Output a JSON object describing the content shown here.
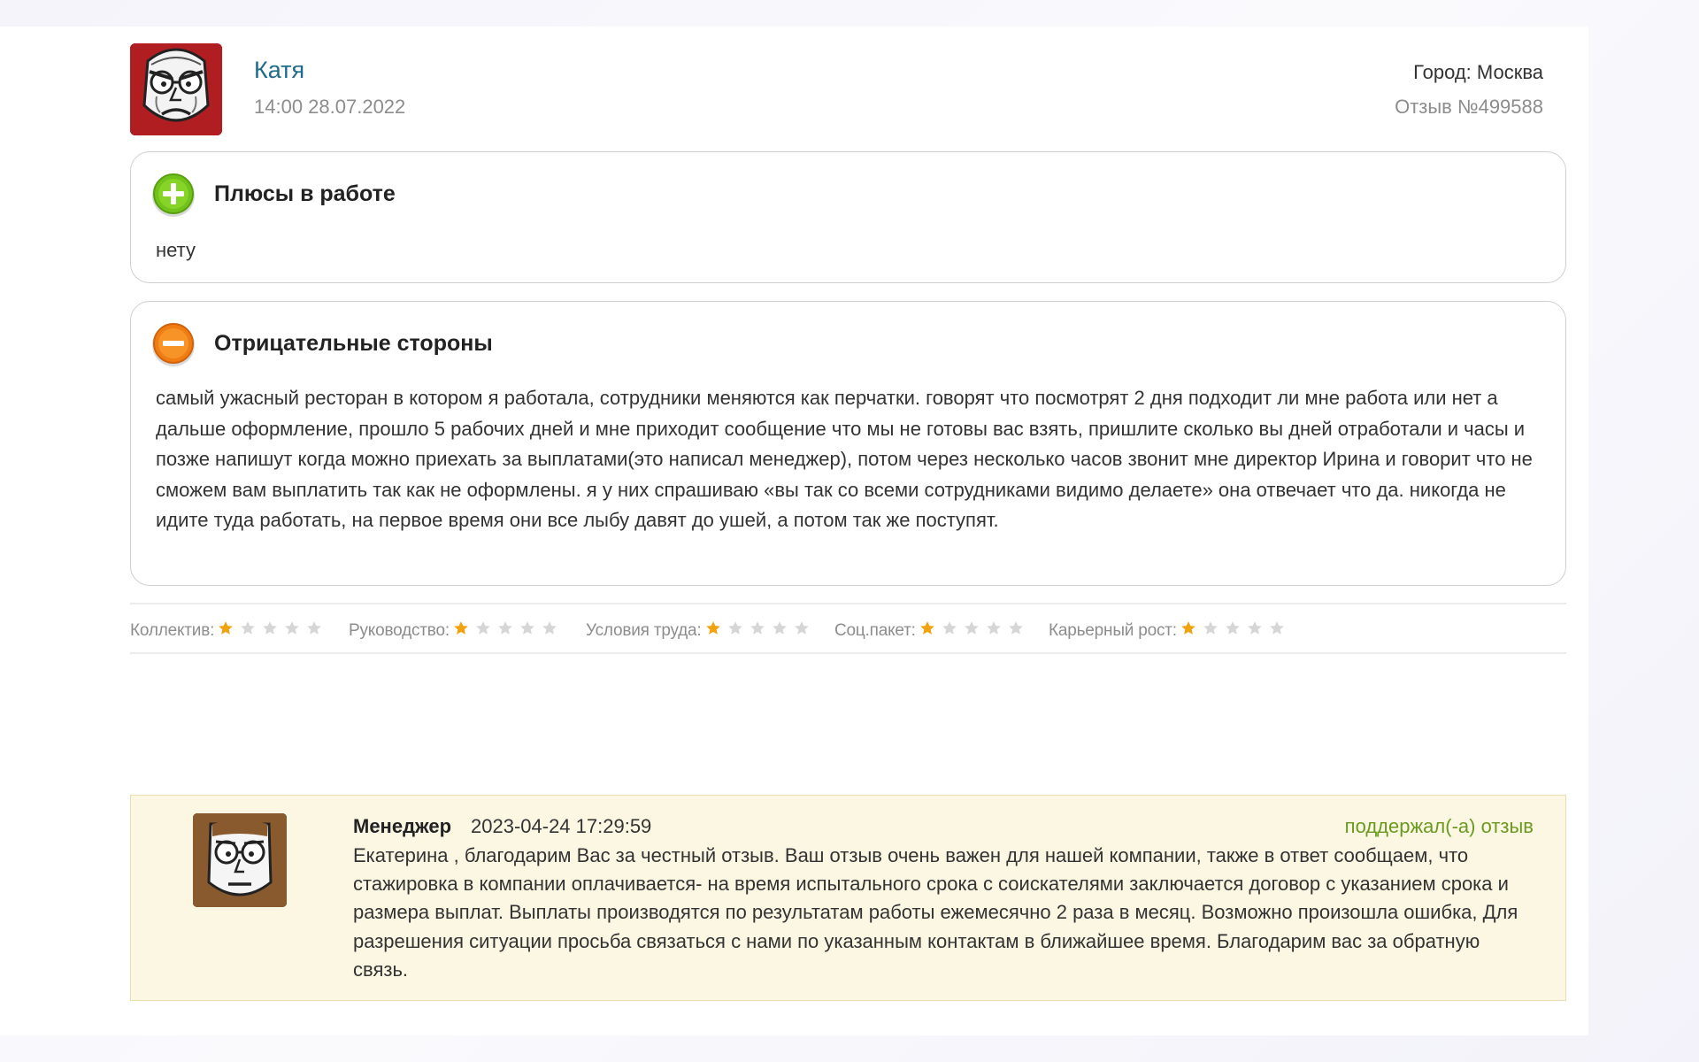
{
  "review": {
    "author": "Катя",
    "date": "14:00 28.07.2022",
    "city": "Город: Москва",
    "number": "Отзыв №499588",
    "pros": {
      "title": "Плюсы в работе",
      "text": "нету"
    },
    "cons": {
      "title": "Отрицательные стороны",
      "text": "самый ужасный ресторан в котором я работала, сотрудники меняются как перчатки. говорят что посмотрят 2 дня подходит ли мне работа или нет а дальше оформление, прошло 5 рабочих дней и мне приходит сообщение что мы не готовы вас взять, пришлите сколько вы дней отработали и часы и позже напишут когда можно приехать за выплатами(это написал менеджер), потом через несколько часов звонит мне директор Ирина и говорит что не сможем вам выплатить так как не оформлены. я у них спрашиваю «вы так со всеми сотрудниками видимо делаете» она отвечает что да. никогда не идите туда работать, на первое время они все лыбу давят до ушей, а потом так же поступят."
    },
    "ratings": [
      {
        "label": "Коллектив:",
        "value": 1,
        "max": 5
      },
      {
        "label": "Руководство:",
        "value": 1,
        "max": 5
      },
      {
        "label": "Условия труда:",
        "value": 1,
        "max": 5
      },
      {
        "label": "Соц.пакет:",
        "value": 1,
        "max": 5
      },
      {
        "label": "Карьерный рост:",
        "value": 1,
        "max": 5
      }
    ]
  },
  "reply": {
    "author": "Менеджер",
    "date": "2023-04-24 17:29:59",
    "support_label": "поддержал(-а) отзыв",
    "text": "Екатерина , благодарим Вас за честный отзыв. Ваш отзыв очень важен для нашей компании, также в ответ сообщаем, что стажировка в компании оплачивается- на время испытального срока с соискателями заключается договор с указанием срока и размера выплат. Выплаты производятся по результатам работы ежемесячно 2 раза в месяц. Возможно произошла ошибка, Для разрешения ситуации просьба связаться с нами по указанным контактам в ближайшее время. Благодарим вас за обратную связь."
  },
  "colors": {
    "author_link": "#1f6b8a",
    "star_filled": "#f2a20c",
    "star_empty": "#d6d6d6",
    "support": "#6a9a1f",
    "reply_bg": "#fbf7e2"
  },
  "icons": {
    "pros": "plus-circle-icon",
    "cons": "minus-circle-icon",
    "rating": "star-icon"
  }
}
